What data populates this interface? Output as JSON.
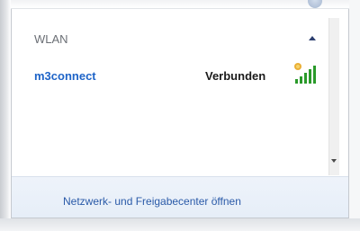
{
  "section": {
    "title": "WLAN",
    "collapse_icon": "chevron-up-icon"
  },
  "network": {
    "name": "m3connect",
    "status": "Verbunden",
    "signal_icon": "wifi-signal-bars-icon",
    "signal_level": 5,
    "signal_max": 5
  },
  "footer": {
    "link_label": "Netzwerk- und Freigabecenter öffnen"
  },
  "colors": {
    "link": "#1e64c8",
    "footer_link": "#2a5aa8",
    "signal_green": "#2a9a2a"
  }
}
